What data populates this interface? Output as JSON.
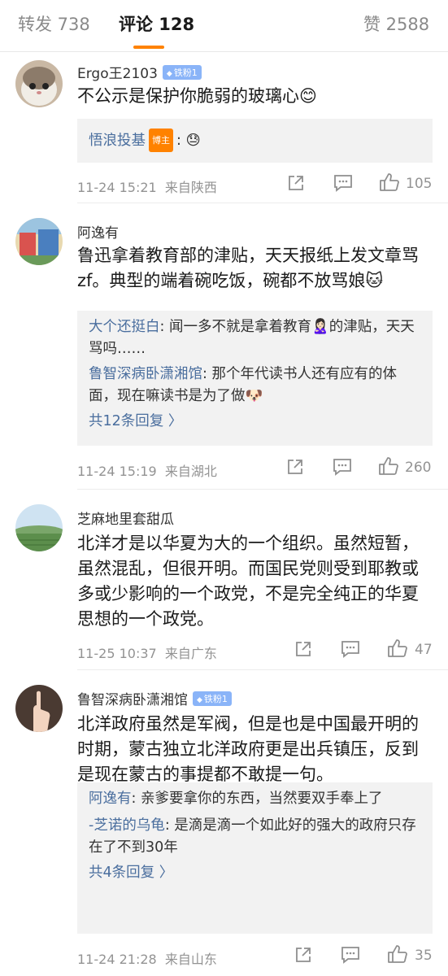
{
  "tabs": [
    {
      "label": "转发 738"
    },
    {
      "label": "评论 128"
    },
    {
      "label": "赞 2588"
    }
  ],
  "comments": [
    {
      "user": "Ergo王2103",
      "badge": "铁粉1",
      "text": "不公示是保护你脆弱的玻璃心😊",
      "replies": [
        {
          "name": "悟浪投基",
          "host_badge": "博主",
          "text": ": 😓"
        }
      ],
      "more": "",
      "time": "11-24 15:21",
      "location": "来自陕西",
      "likes": "105"
    },
    {
      "user": "阿逸有",
      "badge": "",
      "text": "鲁迅拿着教育部的津贴，天天报纸上发文章骂zf。典型的端着碗吃饭，碗都不放骂娘🐱",
      "replies": [
        {
          "name": "大个还挺白",
          "text": ": 闻一多不就是拿着教育🙎🏻‍♀️的津贴，天天骂吗……"
        },
        {
          "name": "鲁智深病卧潇湘馆",
          "text": ": 那个年代读书人还有应有的体面，现在嘛读书是为了做🐶"
        }
      ],
      "more": "共12条回复 〉",
      "time": "11-24 15:19",
      "location": "来自湖北",
      "likes": "260"
    },
    {
      "user": "芝麻地里套甜瓜",
      "badge": "",
      "text": "北洋才是以华夏为大的一个组织。虽然短暂，虽然混乱，但很开明。而国民党则受到耶教或多或少影响的一个政党，不是完全纯正的华夏思想的一个政党。",
      "replies": [],
      "more": "",
      "time": "11-25 10:37",
      "location": "来自广东",
      "likes": "47"
    },
    {
      "user": "鲁智深病卧潇湘馆",
      "badge": "铁粉1",
      "text": "北洋政府虽然是军阀，但是也是中国最开明的时期，蒙古独立北洋政府更是出兵镇压，反到是现在蒙古的事提都不敢提一句。",
      "replies": [
        {
          "name": "阿逸有",
          "text": ": 亲爹要拿你的东西，当然要双手奉上了"
        },
        {
          "name": "-芝诺的乌龟",
          "text": ": 是滴是滴一个如此好的强大的政府只存在了不到30年"
        }
      ],
      "more": "共4条回复 〉",
      "time": "11-24 21:28",
      "location": "来自山东",
      "likes": "35"
    }
  ]
}
